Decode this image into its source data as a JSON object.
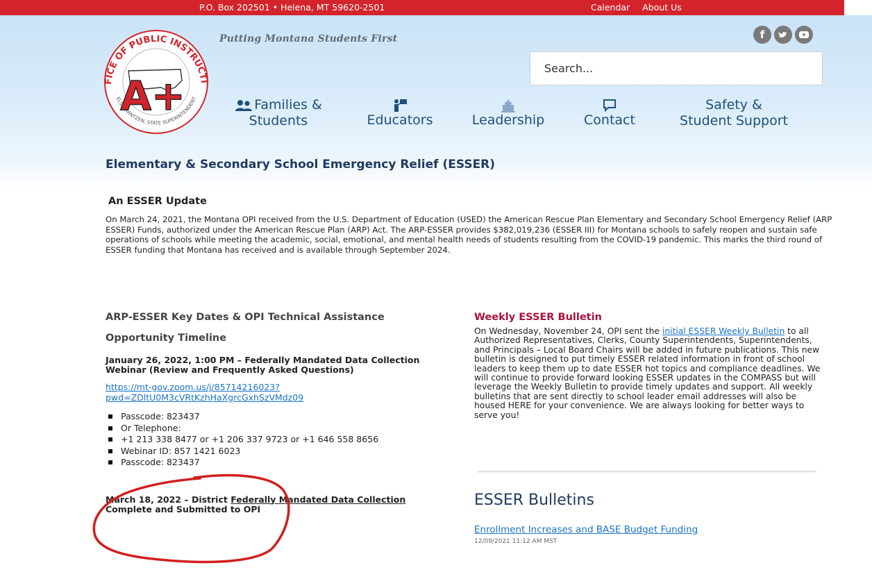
{
  "topbar": {
    "address": "P.O. Box 202501 • Helena, MT 59620-2501",
    "links": [
      "Calendar",
      "About Us"
    ]
  },
  "header": {
    "logo_text": {
      "ring_top": "OFFICE OF PUBLIC INSTRUCTION",
      "ring_bottom": "ELSIE ARNTZEN, STATE SUPERINTENDENT",
      "grade": "A+"
    },
    "tagline": "Putting Montana Students First",
    "social_icons": [
      "facebook-icon",
      "twitter-icon",
      "youtube-icon"
    ],
    "search_placeholder": "Search..."
  },
  "nav": {
    "families": {
      "line1": "Families &",
      "line2": "Students"
    },
    "educators": {
      "label": "Educators"
    },
    "leadership": {
      "label": "Leadership"
    },
    "contact": {
      "label": "Contact"
    },
    "safety": {
      "line1": "Safety &",
      "line2": "Student Support"
    }
  },
  "page_title": "Elementary & Secondary School Emergency Relief (ESSER)",
  "update": {
    "heading": "An ESSER Update",
    "body": "On March 24, 2021, the Montana OPI received from the U.S. Department of Education (USED) the American Rescue Plan Elementary and Secondary School Emergency Relief (ARP ESSER) Funds, authorized under the American Rescue Plan (ARP) Act. The ARP-ESSER provides $382,019,236 (ESSER III) for Montana schools to safely reopen and sustain safe operations of schools while meeting the academic, social, emotional, and mental health needs of students resulting from the COVID-19 pandemic. This marks the third round of ESSER funding that Montana has received and is available through September 2024."
  },
  "timeline": {
    "heading1": "ARP-ESSER Key Dates & OPI Technical Assistance",
    "heading2": "Opportunity Timeline",
    "event1": {
      "title_line1": "January 26, 2022, 1:00 PM – Federally Mandated Data Collection",
      "title_line2": "Webinar (Review and Frequently Asked Questions)",
      "link_line1": "https://mt-gov.zoom.us/j/85714216023?",
      "link_line2": "pwd=ZDltU0M3cVRtKzhHaXgrcGxhSzVMdz09",
      "bullets": [
        "Passcode: 823437",
        "Or Telephone:",
        "+1 213 338 8477  or +1 206 337 9723  or +1 646 558 8656",
        "Webinar ID: 857 1421 6023",
        "Passcode: 823437"
      ]
    },
    "event2": {
      "prefix": "March 18, 2022 – District ",
      "link": "Federally Mandated Data Collection",
      "line2": "Complete and Submitted to OPI"
    }
  },
  "bulletin": {
    "heading": "Weekly ESSER Bulletin",
    "text_before": "On Wednesday, November 24, OPI sent the ",
    "link": "initial ESSER Weekly Bulletin",
    "text_after": " to all Authorized Representatives, Clerks, County Superintendents, Superintendents, and Principals – Local Board Chairs will be added in future publications.  This new bulletin is designed to put timely ESSER related information in front of school leaders to keep them up to date ESSER hot topics and compliance deadlines.  We will continue to provide forward looking ESSER updates in the COMPASS but will leverage the Weekly Bulletin to provide timely updates and support.  All weekly bulletins that are sent directly to school leader email addresses will also be housed HERE for your convenience.  We are always looking for better ways to serve you!"
  },
  "bulletins_list": {
    "heading": "ESSER Bulletins",
    "items": [
      {
        "title": "Enrollment Increases and BASE Budget Funding",
        "date": "12/09/2021 11:12 AM MST"
      }
    ]
  },
  "colors": {
    "topbar": "#d3242b",
    "nav_text": "#1f4e79",
    "link": "#1a73c8",
    "bulletin_heading": "#a8123a",
    "annotation_circle": "#d11f1f"
  }
}
